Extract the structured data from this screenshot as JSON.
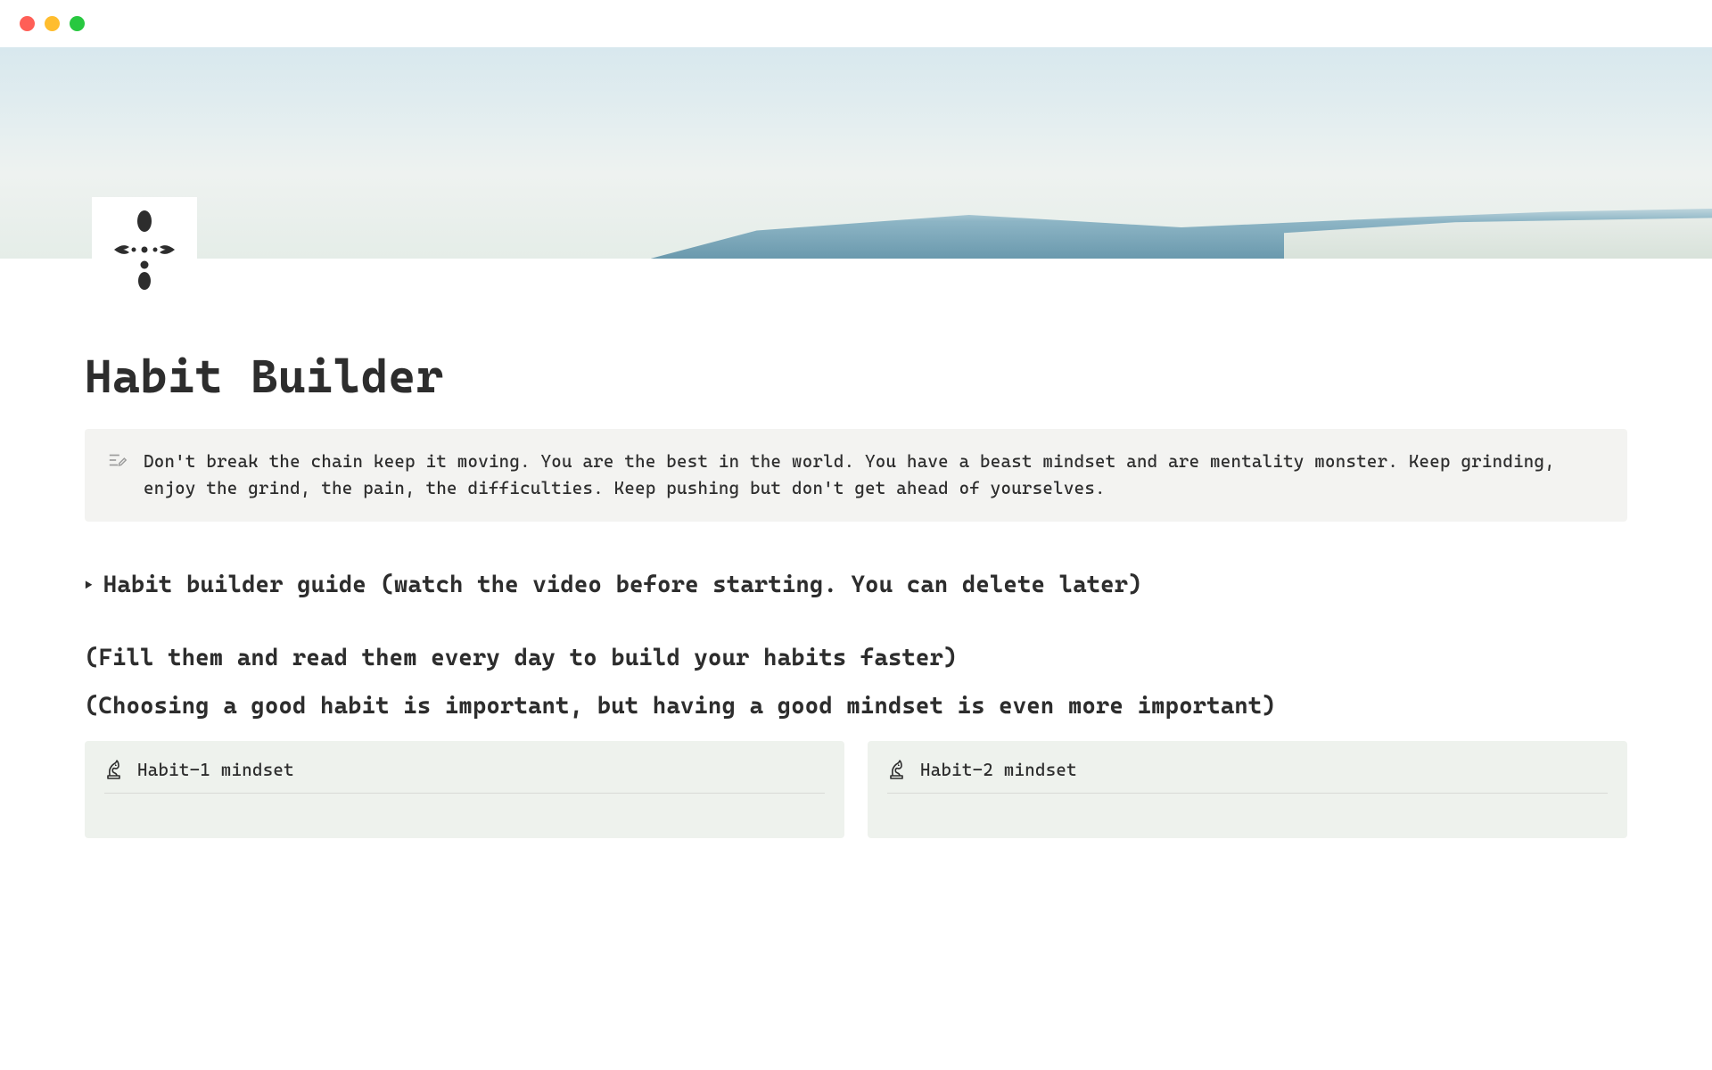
{
  "page": {
    "title": "Habit Builder"
  },
  "callout": {
    "text": "Don't break the chain keep it moving. You are the best in the world. You have a beast mindset and are mentality monster. Keep grinding, enjoy the grind, the pain, the difficulties. Keep pushing but don't get ahead of yourselves."
  },
  "toggle_heading": {
    "text": "Habit builder guide (watch the video before starting. You can delete later)"
  },
  "subheadings": {
    "line1": "(Fill them and read them every day to build your habits faster)",
    "line2": "(Choosing a good habit is important, but having a good mindset is even more important)"
  },
  "habits": [
    {
      "title": "Habit-1 mindset"
    },
    {
      "title": "Habit-2 mindset"
    }
  ]
}
